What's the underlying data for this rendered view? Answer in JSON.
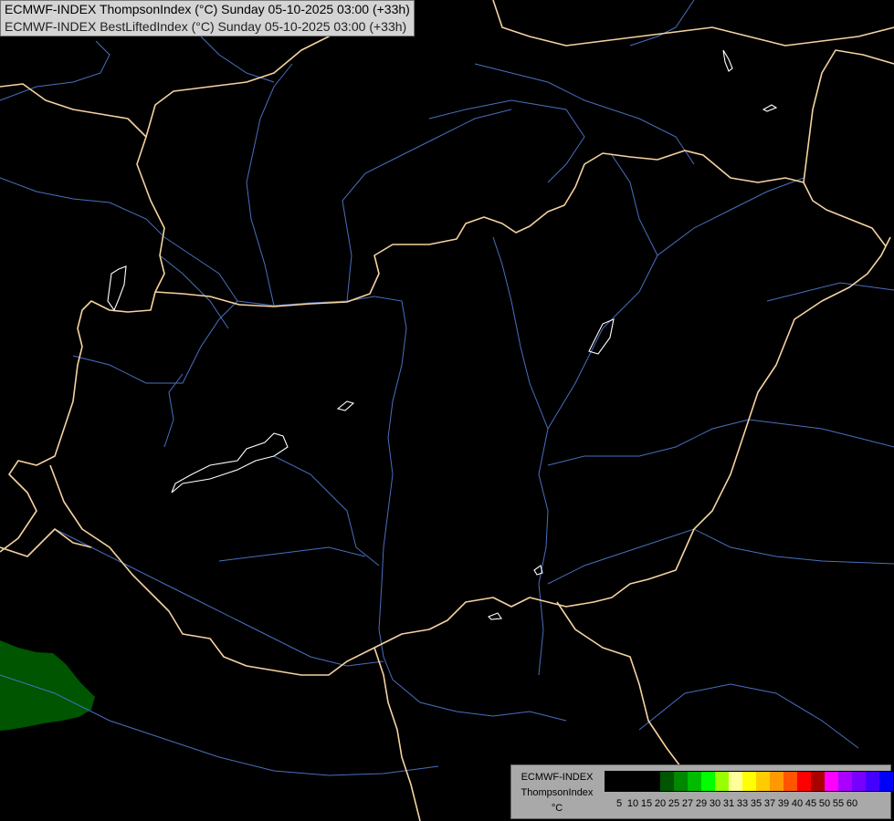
{
  "header": {
    "line1": "ECMWF-INDEX ThompsonIndex (°C) Sunday 05-10-2025 03:00 (+33h)",
    "line2": "ECMWF-INDEX BestLiftedIndex (°C) Sunday 05-10-2025 03:00 (+33h)"
  },
  "legend": {
    "title1": "ECMWF-INDEX",
    "title2": "ThompsonIndex",
    "unit": "°C",
    "ticks": [
      "5",
      "10",
      "15",
      "20",
      "25",
      "27",
      "29",
      "30",
      "31",
      "33",
      "35",
      "37",
      "39",
      "40",
      "45",
      "50",
      "55",
      "60"
    ],
    "colors": [
      "#000000",
      "#000000",
      "#000000",
      "#000000",
      "#005500",
      "#008800",
      "#00bb00",
      "#00ff00",
      "#99ff00",
      "#ffff99",
      "#ffff00",
      "#ffcc00",
      "#ff9900",
      "#ff5500",
      "#ff0000",
      "#aa0000",
      "#ff00ff",
      "#aa00ff",
      "#7700ff",
      "#4400ff",
      "#0000ff"
    ]
  },
  "map_colors": {
    "background": "#000000",
    "borders": "#f5d3a0",
    "rivers": "#4a6fbf",
    "lakes": "#ffffff",
    "fill_25": "#005500"
  }
}
